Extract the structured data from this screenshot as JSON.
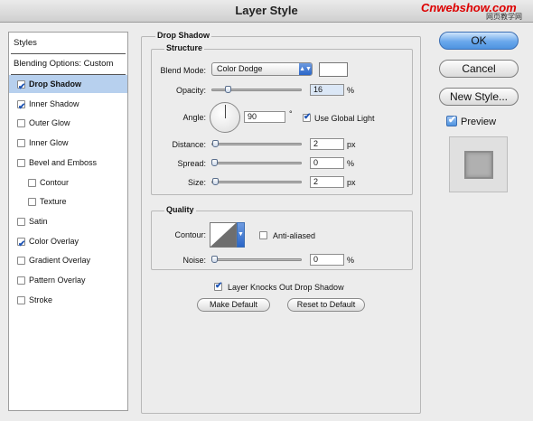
{
  "window": {
    "title": "Layer Style"
  },
  "watermark": {
    "text": "Cnwebshow.com",
    "sub": "网页教学网"
  },
  "styles_list": {
    "header": "Styles",
    "blending": "Blending Options: Custom",
    "items": [
      {
        "label": "Drop Shadow",
        "checked": true,
        "selected": true
      },
      {
        "label": "Inner Shadow",
        "checked": true
      },
      {
        "label": "Outer Glow",
        "checked": false
      },
      {
        "label": "Inner Glow",
        "checked": false
      },
      {
        "label": "Bevel and Emboss",
        "checked": false
      },
      {
        "label": "Contour",
        "checked": false,
        "indent": true
      },
      {
        "label": "Texture",
        "checked": false,
        "indent": true
      },
      {
        "label": "Satin",
        "checked": false
      },
      {
        "label": "Color Overlay",
        "checked": true
      },
      {
        "label": "Gradient Overlay",
        "checked": false
      },
      {
        "label": "Pattern Overlay",
        "checked": false
      },
      {
        "label": "Stroke",
        "checked": false
      }
    ]
  },
  "panel": {
    "title": "Drop Shadow",
    "structure": {
      "title": "Structure",
      "blend_mode_label": "Blend Mode:",
      "blend_mode_value": "Color Dodge",
      "opacity_label": "Opacity:",
      "opacity_value": "16",
      "opacity_unit": "%",
      "opacity_level": 0.16,
      "angle_label": "Angle:",
      "angle_value": "90",
      "angle_unit": "°",
      "global_light_label": "Use Global Light",
      "global_light_checked": true,
      "distance_label": "Distance:",
      "distance_value": "2",
      "distance_unit": "px",
      "distance_level": 0.01,
      "spread_label": "Spread:",
      "spread_value": "0",
      "spread_unit": "%",
      "spread_level": 0,
      "size_label": "Size:",
      "size_value": "2",
      "size_unit": "px",
      "size_level": 0.01
    },
    "quality": {
      "title": "Quality",
      "contour_label": "Contour:",
      "anti_aliased_label": "Anti-aliased",
      "anti_aliased_checked": false,
      "noise_label": "Noise:",
      "noise_value": "0",
      "noise_unit": "%",
      "noise_level": 0
    },
    "knockout_label": "Layer Knocks Out Drop Shadow",
    "knockout_checked": true,
    "make_default": "Make Default",
    "reset_default": "Reset to Default"
  },
  "buttons": {
    "ok": "OK",
    "cancel": "Cancel",
    "new_style": "New Style...",
    "preview_label": "Preview",
    "preview_checked": true
  },
  "colors": {
    "accent": "#4e93e0",
    "selection": "#b7d0ee",
    "swatch": "#ffffff"
  }
}
